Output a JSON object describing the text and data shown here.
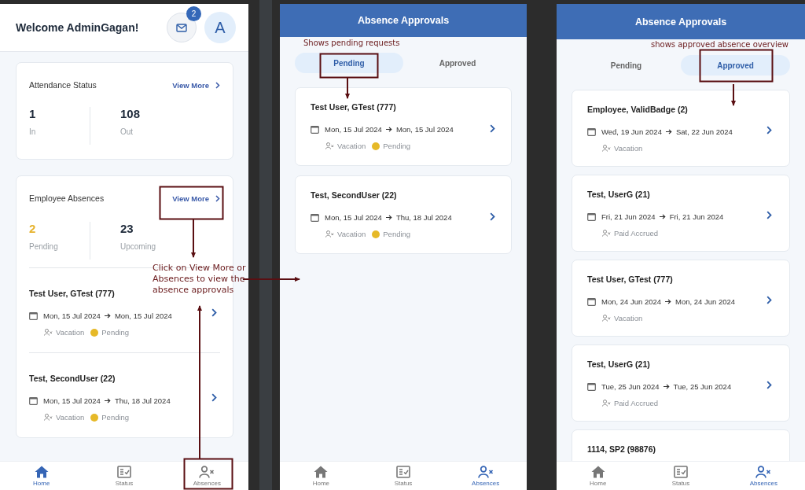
{
  "panels": [
    {
      "kind": "home",
      "greeting": "Welcome AdminGagan!",
      "mail_badge": "2",
      "avatar": "A",
      "attendance": {
        "title": "Attendance Status",
        "link": "View More",
        "stats": [
          {
            "value": "1",
            "label": "In",
            "color": "#1e2a3a"
          },
          {
            "value": "108",
            "label": "Out",
            "color": "#1e2a3a"
          }
        ]
      },
      "absences": {
        "title": "Employee Absences",
        "link": "View More",
        "stats": [
          {
            "value": "2",
            "label": "Pending",
            "color": "#e6b22c"
          },
          {
            "value": "23",
            "label": "Upcoming",
            "color": "#1e2a3a"
          }
        ],
        "items": [
          {
            "name": "Test User, GTest (777)",
            "from": "Mon, 15 Jul 2024",
            "to": "Mon, 15 Jul 2024",
            "type": "Vacation",
            "status": {
              "label": "Pending",
              "color": "#e6b928"
            }
          },
          {
            "name": "Test, SecondUser (22)",
            "from": "Mon, 15 Jul 2024",
            "to": "Thu, 18 Jul 2024",
            "type": "Vacation",
            "status": {
              "label": "Pending",
              "color": "#e6b928"
            }
          }
        ]
      },
      "nav": [
        {
          "label": "Home",
          "selected": true
        },
        {
          "label": "Status",
          "selected": false
        },
        {
          "label": "Absences",
          "selected": false
        }
      ]
    },
    {
      "kind": "approvals",
      "title": "Absence Approvals",
      "tabs": [
        {
          "label": "Pending",
          "selected": true
        },
        {
          "label": "Approved",
          "selected": false
        }
      ],
      "items": [
        {
          "name": "Test User, GTest (777)",
          "from": "Mon, 15 Jul 2024",
          "to": "Mon, 15 Jul 2024",
          "type": "Vacation",
          "status": {
            "label": "Pending",
            "color": "#e6b928"
          }
        },
        {
          "name": "Test, SecondUser (22)",
          "from": "Mon, 15 Jul 2024",
          "to": "Thu, 18 Jul 2024",
          "type": "Vacation",
          "status": {
            "label": "Pending",
            "color": "#e6b928"
          }
        }
      ],
      "nav": [
        {
          "label": "Home",
          "selected": false
        },
        {
          "label": "Status",
          "selected": false
        },
        {
          "label": "Absences",
          "selected": true
        }
      ]
    },
    {
      "kind": "approvals",
      "title": "Absence Approvals",
      "tabs": [
        {
          "label": "Pending",
          "selected": false
        },
        {
          "label": "Approved",
          "selected": true
        }
      ],
      "items": [
        {
          "name": "Employee, ValidBadge (2)",
          "from": "Wed, 19 Jun 2024",
          "to": "Sat, 22 Jun 2024",
          "type": "Vacation"
        },
        {
          "name": "Test, UserG (21)",
          "from": "Fri, 21 Jun 2024",
          "to": "Fri, 21 Jun 2024",
          "type": "Paid Accrued"
        },
        {
          "name": "Test User, GTest (777)",
          "from": "Mon, 24 Jun 2024",
          "to": "Mon, 24 Jun 2024",
          "type": "Vacation"
        },
        {
          "name": "Test, UserG (21)",
          "from": "Tue, 25 Jun 2024",
          "to": "Tue, 25 Jun 2024",
          "type": "Paid Accrued"
        },
        {
          "name": "1114, SP2 (98876)"
        }
      ],
      "nav": [
        {
          "label": "Home",
          "selected": false
        },
        {
          "label": "Status",
          "selected": false
        },
        {
          "label": "Absences",
          "selected": true
        }
      ]
    }
  ],
  "annotations": [
    {
      "text": "Click on View More or Absences to view the absence approvals"
    },
    {
      "text": "Shows pending requests"
    },
    {
      "text": "shows approved absence overview"
    }
  ]
}
